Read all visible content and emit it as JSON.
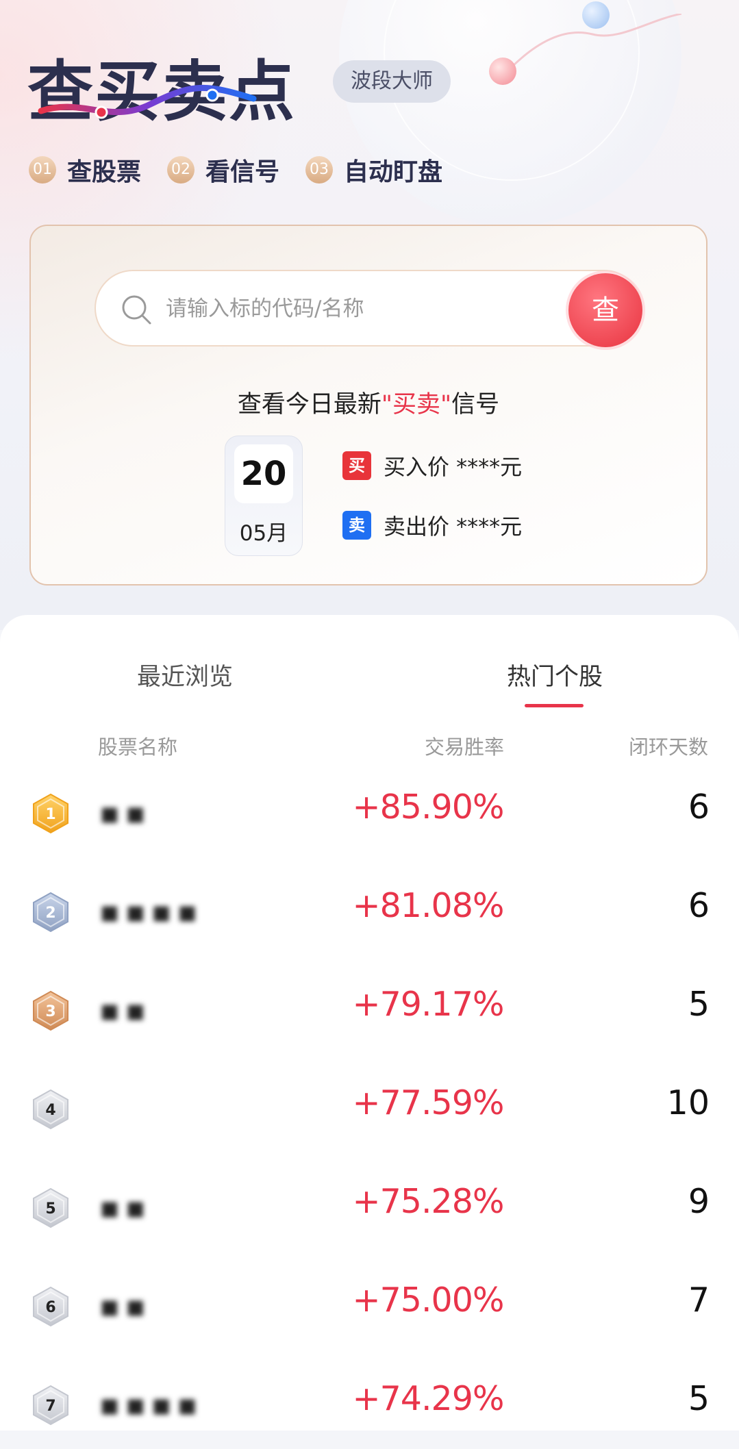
{
  "header": {
    "logo_text": "查买卖点",
    "badge": "波段大师",
    "steps": [
      {
        "num": "01",
        "label": "查股票"
      },
      {
        "num": "02",
        "label": "看信号"
      },
      {
        "num": "03",
        "label": "自动盯盘"
      }
    ]
  },
  "search": {
    "placeholder": "请输入标的代码/名称",
    "button_label": "查",
    "signal_title_prefix": "查看今日最新",
    "signal_title_highlight": "\"买卖\"",
    "signal_title_suffix": "信号",
    "date_day": "20",
    "date_month": "05月",
    "buy_chip": "买",
    "buy_text": "买入价 ****元",
    "sell_chip": "卖",
    "sell_text": "卖出价 ****元"
  },
  "tabs": {
    "recent": "最近浏览",
    "hot": "热门个股",
    "active": "hot"
  },
  "table": {
    "headers": {
      "name": "股票名称",
      "rate": "交易胜率",
      "days": "闭环天数"
    },
    "rows": [
      {
        "rank": "1",
        "name": "▪▪",
        "rate": "+85.90%",
        "days": "6"
      },
      {
        "rank": "2",
        "name": "▪▪▪▪",
        "rate": "+81.08%",
        "days": "6"
      },
      {
        "rank": "3",
        "name": "▪▪",
        "rate": "+79.17%",
        "days": "5"
      },
      {
        "rank": "4",
        "name": "",
        "rate": "+77.59%",
        "days": "10"
      },
      {
        "rank": "5",
        "name": "▪▪",
        "rate": "+75.28%",
        "days": "9"
      },
      {
        "rank": "6",
        "name": "▪▪",
        "rate": "+75.00%",
        "days": "7"
      },
      {
        "rank": "7",
        "name": "▪▪▪▪",
        "rate": "+74.29%",
        "days": "5"
      }
    ]
  },
  "colors": {
    "accent_red": "#e8344a",
    "buy_red": "#e8343a",
    "sell_blue": "#1f6ff2",
    "gold": "#f5b335",
    "silver": "#9fb0cc",
    "bronze": "#d99a67",
    "gray": "#c9cbd1"
  }
}
